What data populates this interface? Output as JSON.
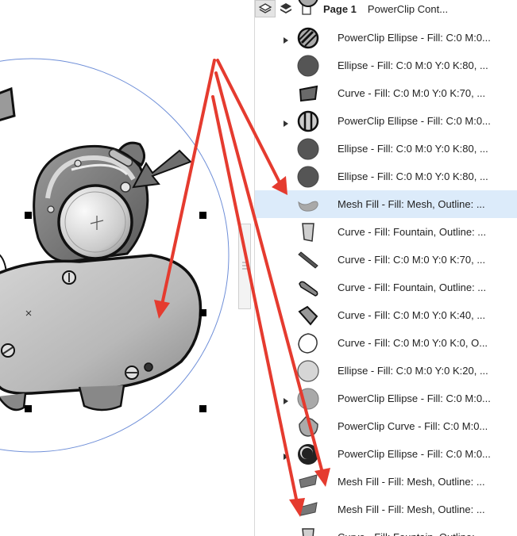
{
  "toolbar": {
    "page_label": "Page 1",
    "object_label": "PowerClip Cont..."
  },
  "objects": [
    {
      "label": "PowerClip Ellipse - Fill: C:0 M:0...",
      "icon": "striped-disc-icon",
      "expandable": true,
      "selected": false
    },
    {
      "label": "Ellipse - Fill: C:0 M:0 Y:0 K:80, ...",
      "icon": "dark-circle-icon",
      "expandable": false,
      "selected": false
    },
    {
      "label": "Curve - Fill: C:0 M:0 Y:0 K:70, ...",
      "icon": "dark-quad-icon",
      "expandable": false,
      "selected": false
    },
    {
      "label": "PowerClip Ellipse - Fill: C:0 M:0...",
      "icon": "slotted-disc-icon",
      "expandable": true,
      "selected": false
    },
    {
      "label": "Ellipse - Fill: C:0 M:0 Y:0 K:80, ...",
      "icon": "dark-circle-icon",
      "expandable": false,
      "selected": false
    },
    {
      "label": "Ellipse - Fill: C:0 M:0 Y:0 K:80, ...",
      "icon": "dark-circle-icon",
      "expandable": false,
      "selected": false
    },
    {
      "label": "Mesh Fill - Fill: Mesh, Outline: ...",
      "icon": "mesh-blob-icon",
      "expandable": false,
      "selected": true
    },
    {
      "label": "Curve - Fill: Fountain, Outline: ...",
      "icon": "fountain-shard-icon",
      "expandable": false,
      "selected": false
    },
    {
      "label": "Curve - Fill: C:0 M:0 Y:0 K:70, ...",
      "icon": "dark-slash-icon",
      "expandable": false,
      "selected": false
    },
    {
      "label": "Curve - Fill: Fountain, Outline: ...",
      "icon": "fountain-stick-icon",
      "expandable": false,
      "selected": false
    },
    {
      "label": "Curve - Fill: C:0 M:0 Y:0 K:40, ...",
      "icon": "grey-quad-icon",
      "expandable": false,
      "selected": false
    },
    {
      "label": "Curve - Fill: C:0 M:0 Y:0 K:0, O...",
      "icon": "white-blob-icon",
      "expandable": false,
      "selected": false
    },
    {
      "label": "Ellipse - Fill: C:0 M:0 Y:0 K:20, ...",
      "icon": "light-circle-icon",
      "expandable": false,
      "selected": false
    },
    {
      "label": "PowerClip Ellipse - Fill: C:0 M:0...",
      "icon": "grey-disc-icon",
      "expandable": true,
      "selected": false
    },
    {
      "label": "PowerClip Curve - Fill: C:0 M:0...",
      "icon": "grey-shape-icon",
      "expandable": false,
      "selected": false
    },
    {
      "label": "PowerClip Ellipse - Fill: C:0 M:0...",
      "icon": "black-ring-icon",
      "expandable": true,
      "selected": false
    },
    {
      "label": "Mesh Fill - Fill: Mesh, Outline: ...",
      "icon": "mesh-wedge-icon",
      "expandable": false,
      "selected": false
    },
    {
      "label": "Mesh Fill - Fill: Mesh, Outline: ...",
      "icon": "mesh-wedge-icon",
      "expandable": false,
      "selected": false
    },
    {
      "label": "Curve - Fill: Fountain, Outline: ...",
      "icon": "fountain-shard-icon",
      "expandable": false,
      "selected": false
    }
  ],
  "colors": {
    "annotation_arrow": "#e53b2f",
    "selection": "#dcebfa",
    "guide_circle": "#6f8fd8"
  }
}
